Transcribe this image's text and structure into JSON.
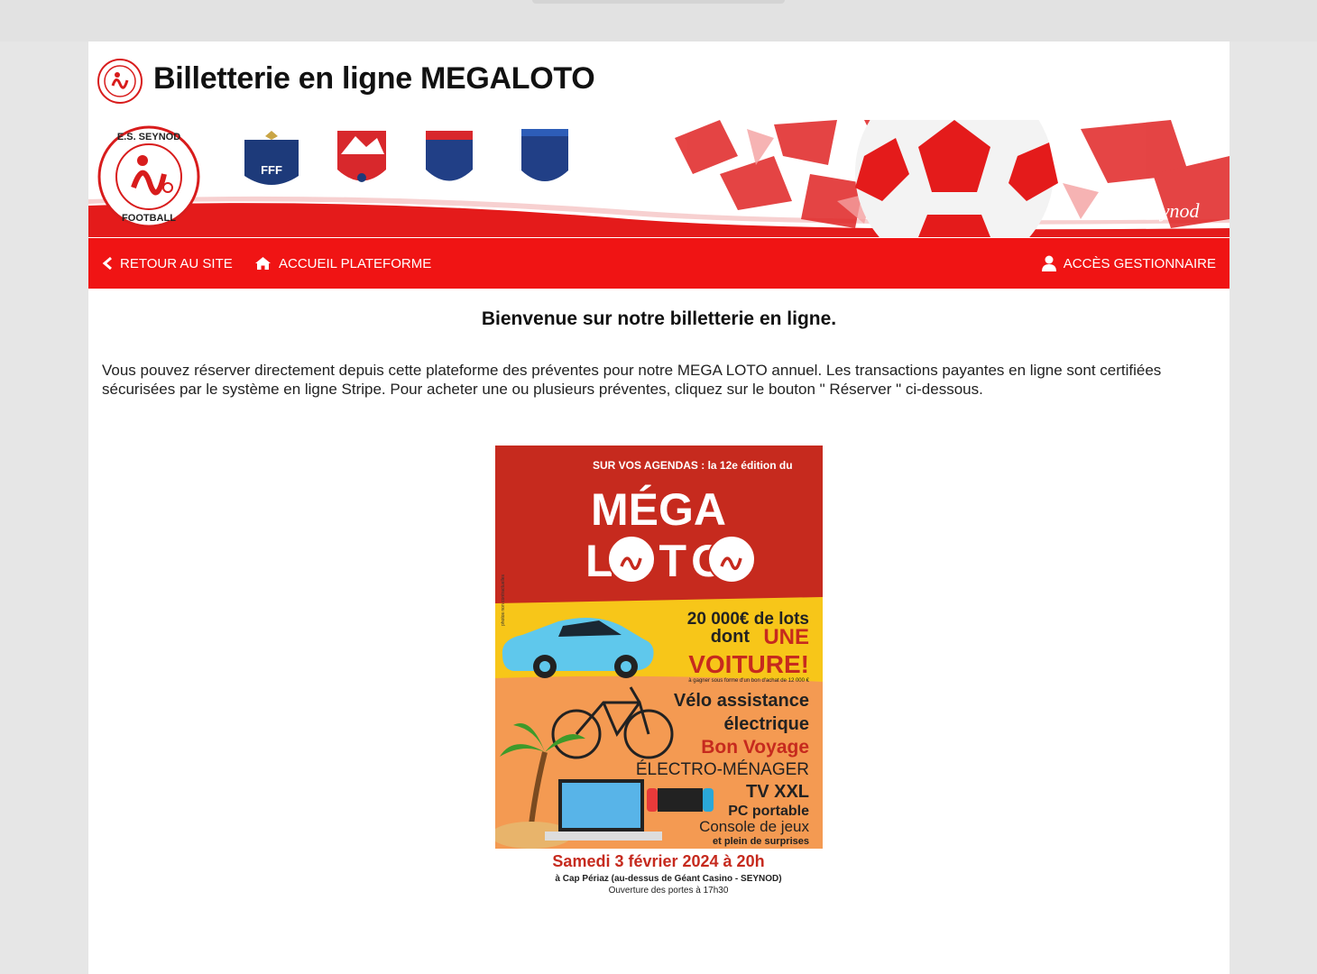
{
  "header": {
    "title": "Billetterie en ligne MEGALOTO"
  },
  "banner": {
    "club_logo_top": "E.S. SEYNOD",
    "club_logo_bottom": "FOOTBALL",
    "fff_label": "FFF",
    "seynod_brand": "Seynod"
  },
  "nav": {
    "back_label": "RETOUR AU SITE",
    "home_label": "ACCUEIL PLATEFORME",
    "admin_label": "ACCÈS GESTIONNAIRE"
  },
  "main": {
    "welcome": "Bienvenue sur notre billetterie en ligne.",
    "intro": "Vous pouvez réserver directement depuis cette plateforme des préventes pour notre MEGA LOTO annuel. Les transactions payantes en ligne sont certifiées sécurisées par le système en ligne Stripe. Pour acheter une ou plusieurs préventes, cliquez sur le bouton \" Réserver \" ci-dessous."
  },
  "poster": {
    "top_line": "SUR VOS AGENDAS : la 12e édition du",
    "title_1": "MÉGA",
    "title_2": "LOTO",
    "photo_note": "photos non contractuelles",
    "prize_line_1": "20 000€ de lots",
    "prize_line_2a": "dont",
    "prize_line_2b": "UNE",
    "prize_line_3": "VOITURE!",
    "prize_note": "à gagner sous forme d'un bon d'achat de 12 000 €",
    "item_1": "Vélo assistance",
    "item_2": "électrique",
    "item_3": "Bon Voyage",
    "item_4": "ÉLECTRO-MÉNAGER",
    "item_5": "TV XXL",
    "item_6": "PC portable",
    "item_7": "Console de jeux",
    "item_8": "et plein de surprises",
    "date": "Samedi 3 février 2024 à 20h",
    "place": "à Cap Périaz (au-dessus de Géant Casino - SEYNOD)",
    "doors": "Ouverture des portes à 17h30"
  },
  "colors": {
    "nav_red": "#f01414",
    "poster_red": "#c62a1e",
    "poster_yellow": "#f7c619",
    "poster_orange": "#f49a52"
  }
}
